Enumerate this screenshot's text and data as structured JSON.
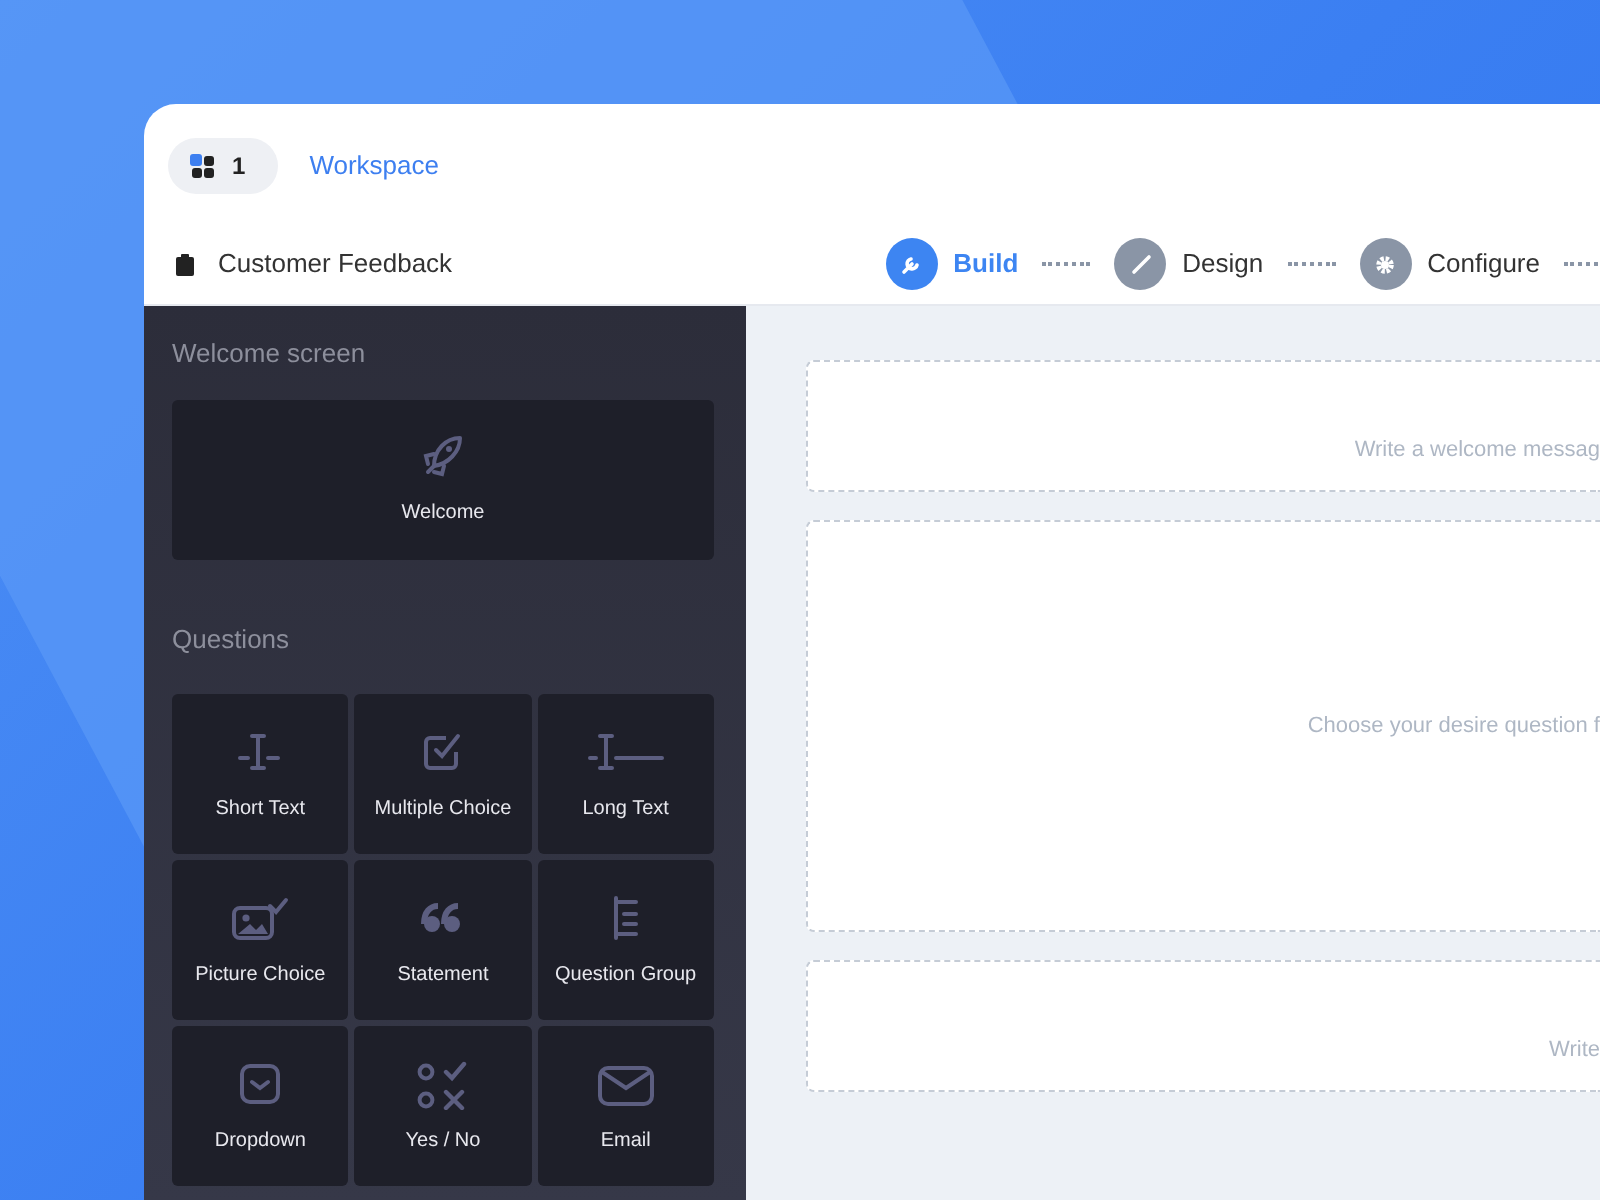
{
  "workspace": {
    "count": "1",
    "label": "Workspace"
  },
  "form": {
    "title": "Customer Feedback"
  },
  "steps": [
    {
      "label": "Build",
      "kind": "build",
      "selected": true
    },
    {
      "label": "Design",
      "kind": "design",
      "selected": false
    },
    {
      "label": "Configure",
      "kind": "configure",
      "selected": false
    }
  ],
  "sidebar": {
    "sections": [
      {
        "title": "Welcome screen",
        "kind": "wide",
        "items": [
          {
            "label": "Welcome",
            "kind": "rocket"
          }
        ]
      },
      {
        "title": "Questions",
        "kind": "grid",
        "items": [
          {
            "label": "Short Text",
            "kind": "short"
          },
          {
            "label": "Multiple Choice",
            "kind": "multiple"
          },
          {
            "label": "Long Text",
            "kind": "long"
          },
          {
            "label": "Picture Choice",
            "kind": "picture"
          },
          {
            "label": "Statement",
            "kind": "quote"
          },
          {
            "label": "Question Group",
            "kind": "group"
          },
          {
            "label": "Dropdown",
            "kind": "dropdown"
          },
          {
            "label": "Yes / No",
            "kind": "yesno"
          },
          {
            "label": "Email",
            "kind": "email"
          }
        ]
      }
    ]
  },
  "canvas": {
    "blocks": [
      {
        "kind": "small",
        "text": "Write a welcome messag"
      },
      {
        "kind": "large",
        "text": "Choose your desire question f"
      },
      {
        "kind": "small",
        "text": "Write"
      }
    ]
  }
}
